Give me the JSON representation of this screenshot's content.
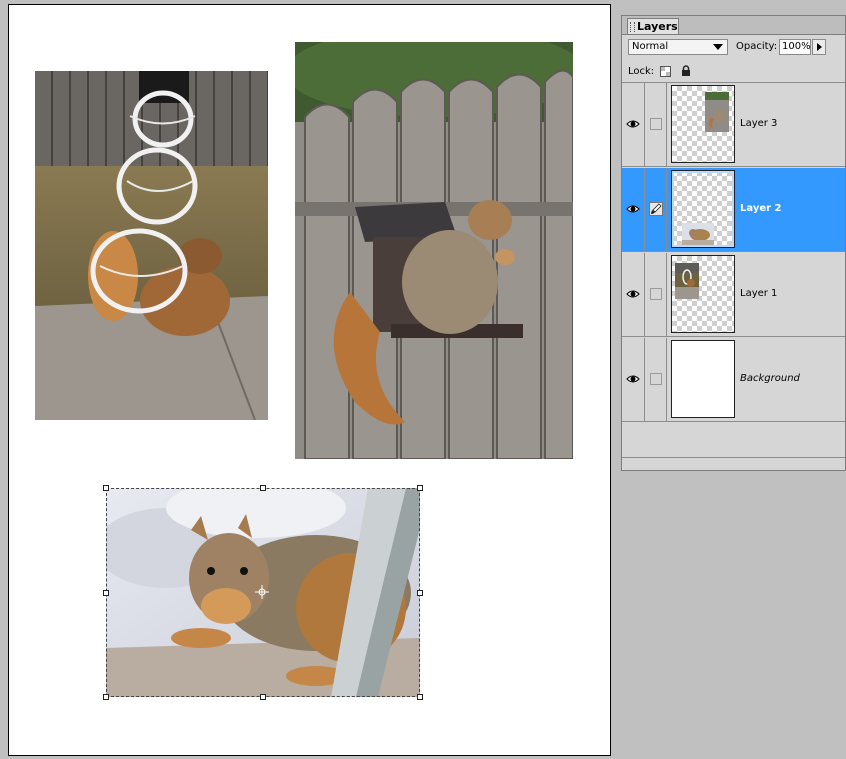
{
  "palette": {
    "tab_label": "Layers",
    "blend_mode": "Normal",
    "opacity_label": "Opacity:",
    "opacity_value": "100%",
    "lock_label": "Lock:",
    "layers": [
      {
        "name": "Layer 3",
        "selected": false,
        "visible": true
      },
      {
        "name": "Layer 2",
        "selected": true,
        "visible": true
      },
      {
        "name": "Layer 1",
        "selected": false,
        "visible": true
      },
      {
        "name": "Background",
        "selected": false,
        "visible": true
      }
    ]
  },
  "canvas": {
    "photos": [
      "squirrel on snowman bird feeder",
      "squirrel on fence feeder",
      "squirrel at window in snow"
    ]
  },
  "colors": {
    "selection_highlight": "#3399ff",
    "palette_bg": "#d6d6d6",
    "workspace_bg": "#c0c0c0"
  }
}
